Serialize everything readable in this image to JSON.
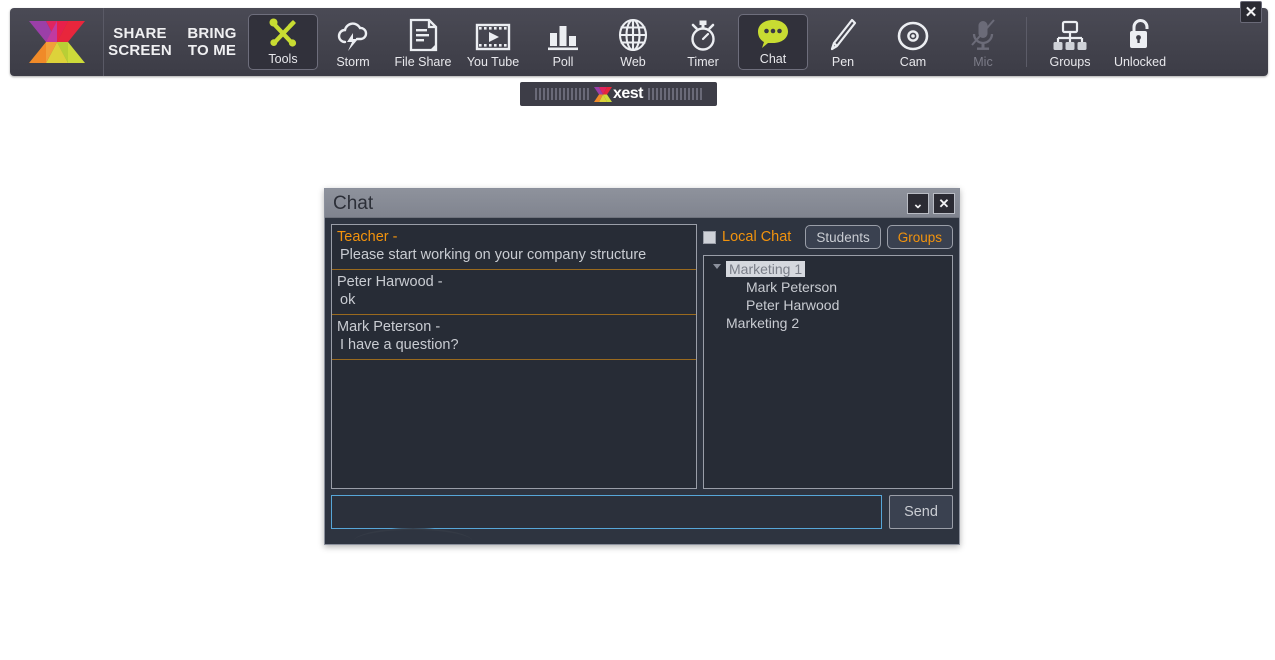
{
  "toolbar": {
    "logo_icon": "xest-x-logo-icon",
    "close_label": "✕",
    "text_buttons": [
      {
        "line1": "SHARE",
        "line2": "SCREEN",
        "name": "share-screen"
      },
      {
        "line1": "BRING",
        "line2": "TO ME",
        "name": "bring-to-me"
      }
    ],
    "icon_buttons": [
      {
        "label": "Tools",
        "icon": "tools-icon",
        "state": "active"
      },
      {
        "label": "Storm",
        "icon": "storm-cloud-icon",
        "state": "normal"
      },
      {
        "label": "File Share",
        "icon": "file-share-icon",
        "state": "normal"
      },
      {
        "label": "You Tube",
        "icon": "youtube-video-icon",
        "state": "normal"
      },
      {
        "label": "Poll",
        "icon": "poll-bars-icon",
        "state": "normal"
      },
      {
        "label": "Web",
        "icon": "globe-icon",
        "state": "normal"
      },
      {
        "label": "Timer",
        "icon": "stopwatch-icon",
        "state": "normal"
      },
      {
        "label": "Chat",
        "icon": "chat-bubble-icon",
        "state": "active"
      },
      {
        "label": "Pen",
        "icon": "pen-icon",
        "state": "normal"
      },
      {
        "label": "Cam",
        "icon": "camera-lens-icon",
        "state": "normal"
      },
      {
        "label": "Mic",
        "icon": "microphone-muted-icon",
        "state": "disabled"
      },
      {
        "label": "Groups",
        "icon": "groups-org-icon",
        "state": "normal"
      },
      {
        "label": "Unlocked",
        "icon": "open-padlock-icon",
        "state": "normal"
      }
    ]
  },
  "grip": {
    "brand": "xest"
  },
  "chat": {
    "title": "Chat",
    "minimize_label": "⌄",
    "close_label": "✕",
    "messages": [
      {
        "who": "Teacher -",
        "body": "Please start working on your company structure",
        "teacher": true
      },
      {
        "who": "Peter Harwood -",
        "body": "ok",
        "teacher": false
      },
      {
        "who": "Mark Peterson -",
        "body": "I have a question?",
        "teacher": false
      }
    ],
    "local_chat_label": "Local Chat",
    "local_chat_checked": false,
    "students_label": "Students",
    "groups_label": "Groups",
    "tree": [
      {
        "label": "Marketing 1",
        "level": 0,
        "selected": true,
        "expander": true
      },
      {
        "label": "Mark Peterson",
        "level": 1,
        "selected": false,
        "expander": false
      },
      {
        "label": "Peter Harwood",
        "level": 1,
        "selected": false,
        "expander": false
      },
      {
        "label": "Marketing 2",
        "level": 0,
        "selected": false,
        "expander": false
      }
    ],
    "input_value": "",
    "input_placeholder": "",
    "send_label": "Send"
  },
  "colors": {
    "accent_orange": "#f2930d",
    "toolbar_bg": "#44444e",
    "dialog_bg": "#2e3440",
    "icon_green": "#c8dc32",
    "focus_border": "#57a6d8"
  }
}
